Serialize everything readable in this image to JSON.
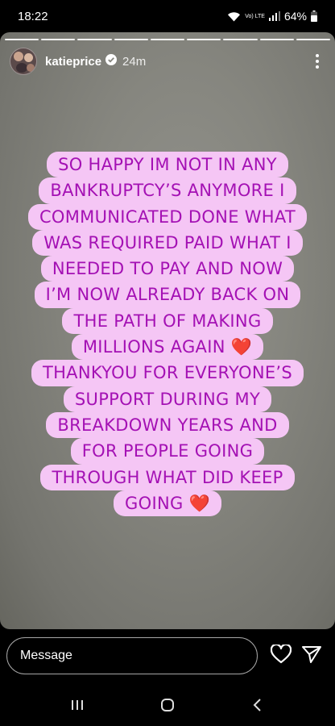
{
  "status_bar": {
    "time": "18:22",
    "network_label": "Vo) LTE",
    "battery": "64%",
    "battery_level": 0.64
  },
  "story": {
    "segments": 9,
    "username": "katieprice",
    "time_ago": "24m",
    "verified": true,
    "text_lines": [
      "SO HAPPY IM NOT IN ANY",
      "BANKRUPTCY’S ANYMORE I",
      "COMMUNICATED DONE WHAT",
      "WAS REQUIRED PAID WHAT I",
      "NEEDED TO PAY AND NOW",
      "I’M NOW ALREADY BACK ON",
      "THE PATH OF MAKING",
      "MILLIONS AGAIN ❤️",
      "THANKYOU FOR EVERYONE’S",
      "SUPPORT DURING MY",
      "BREAKDOWN YEARS AND",
      "FOR PEOPLE GOING",
      "THROUGH WHAT DID KEEP",
      "GOING ❤️"
    ],
    "colors": {
      "sticker_bg": "#f5c6f5",
      "sticker_text": "#a411b4",
      "background": "#86867f"
    }
  },
  "reply": {
    "placeholder": "Message",
    "icons": [
      "heart-icon",
      "send-icon"
    ]
  },
  "nav": {
    "icons": [
      "recent-apps-icon",
      "home-icon",
      "back-icon"
    ]
  }
}
